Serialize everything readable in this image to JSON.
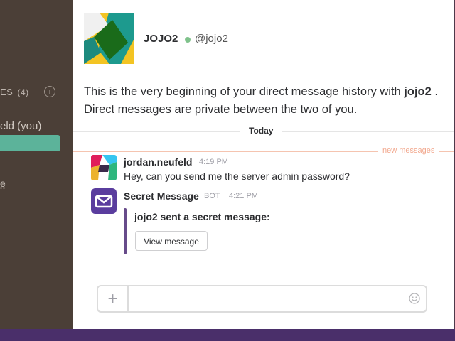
{
  "sidebar": {
    "heading": "ES",
    "count": "(4)",
    "add_label": "+",
    "item_self": "eld (you)",
    "underlined_item": "e"
  },
  "profile": {
    "name": "JOJO2",
    "handle": "@jojo2",
    "presence_color": "#7fc28b"
  },
  "intro": {
    "lead": "This is the very beginning of your direct message history with ",
    "user": "jojo2",
    "tail": " . Direct messages are private between the two of you."
  },
  "dividers": {
    "today": "Today",
    "new_messages": "new messages"
  },
  "messages": [
    {
      "author": "jordan.neufeld",
      "time": "4:19 PM",
      "text": "Hey, can you send me the server admin password?"
    },
    {
      "author": "Secret Message",
      "tag": "BOT",
      "time": "4:21 PM",
      "attachment_text": "jojo2 sent a secret message:",
      "button_label": "View message"
    }
  ],
  "composer": {
    "plus_label": "+",
    "placeholder": ""
  },
  "colors": {
    "sidebar_bg": "#4b3f37",
    "active_item": "#5cb39a",
    "bot_avatar": "#5a3d9e",
    "new_messages": "#f2a98f"
  }
}
